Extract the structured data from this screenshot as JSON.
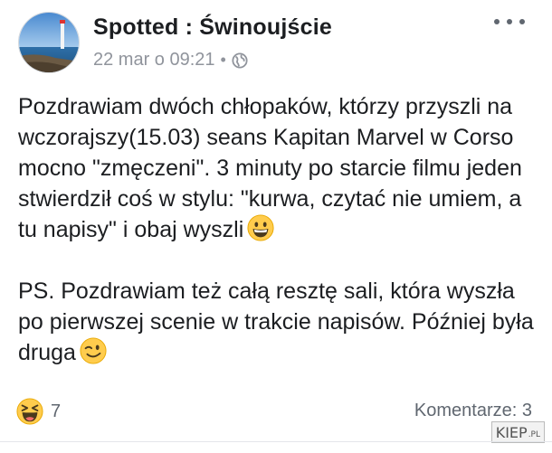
{
  "post": {
    "page_name": "Spotted : Świnoujście",
    "date": "22 mar o 09:21",
    "separator": "•",
    "privacy_icon": "globe-icon",
    "more_icon": "more-options-icon",
    "paragraph1": "Pozdrawiam dwóch chłopaków, którzy przyszli na wczorajszy(15.03) seans Kapitan Marvel w Corso mocno \"zmęczeni\". 3 minuty po starcie filmu jeden stwierdził coś w stylu: \"kurwa, czytać nie umiem, a tu napisy\" i obaj wyszli",
    "paragraph1_emoji": "grinning-face-emoji",
    "paragraph2": "PS. Pozdrawiam też całą resztę sali, która wyszła po pierwszej scenie w trakcie napisów. Później była druga",
    "paragraph2_emoji": "winking-face-emoji"
  },
  "footer": {
    "reaction_icon": "haha-icon",
    "reaction_count": "7",
    "comments_label": "Komentarze: 3"
  },
  "watermark": {
    "brand": "KIEP",
    "tld": ".PL"
  },
  "colors": {
    "text": "#1c1e21",
    "secondary": "#90949c",
    "emoji_yellow": "#ffcc4d"
  }
}
